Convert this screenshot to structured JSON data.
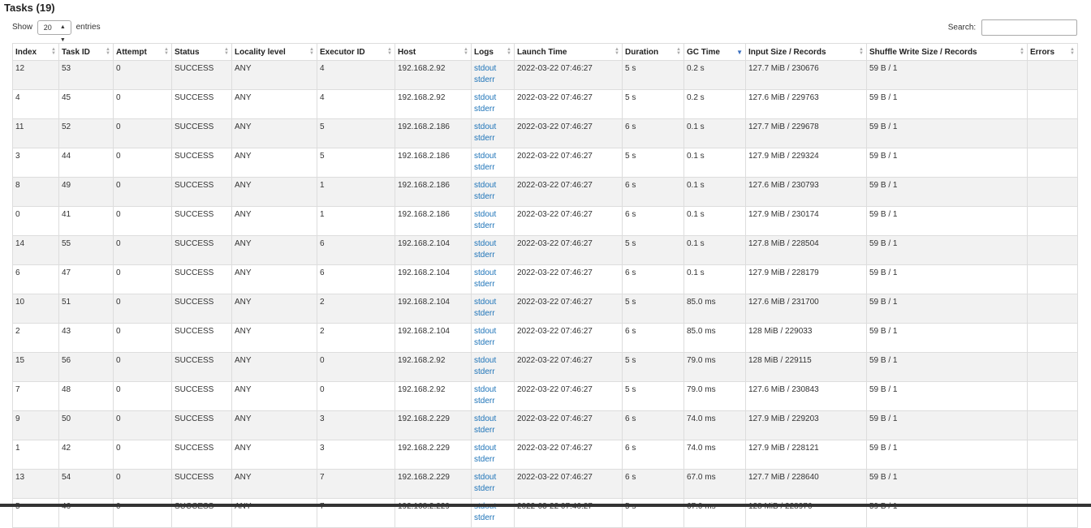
{
  "title": "Tasks (19)",
  "controls": {
    "show_label": "Show",
    "page_size": "20",
    "entries_label": "entries",
    "search_label": "Search:",
    "search_value": ""
  },
  "columns": [
    "Index",
    "Task ID",
    "Attempt",
    "Status",
    "Locality level",
    "Executor ID",
    "Host",
    "Logs",
    "Launch Time",
    "Duration",
    "GC Time",
    "Input Size / Records",
    "Shuffle Write Size / Records",
    "Errors"
  ],
  "sorted_column": "GC Time",
  "rows": [
    {
      "index": "12",
      "task_id": "53",
      "attempt": "0",
      "status": "SUCCESS",
      "locality": "ANY",
      "executor": "4",
      "host": "192.168.2.92",
      "stdout": "stdout",
      "stderr": "stderr",
      "launch": "2022-03-22 07:46:27",
      "duration": "5 s",
      "gc": "0.2 s",
      "input": "127.7 MiB / 230676",
      "shuffle": "59 B / 1",
      "errors": ""
    },
    {
      "index": "4",
      "task_id": "45",
      "attempt": "0",
      "status": "SUCCESS",
      "locality": "ANY",
      "executor": "4",
      "host": "192.168.2.92",
      "stdout": "stdout",
      "stderr": "stderr",
      "launch": "2022-03-22 07:46:27",
      "duration": "5 s",
      "gc": "0.2 s",
      "input": "127.6 MiB / 229763",
      "shuffle": "59 B / 1",
      "errors": ""
    },
    {
      "index": "11",
      "task_id": "52",
      "attempt": "0",
      "status": "SUCCESS",
      "locality": "ANY",
      "executor": "5",
      "host": "192.168.2.186",
      "stdout": "stdout",
      "stderr": "stderr",
      "launch": "2022-03-22 07:46:27",
      "duration": "6 s",
      "gc": "0.1 s",
      "input": "127.7 MiB / 229678",
      "shuffle": "59 B / 1",
      "errors": ""
    },
    {
      "index": "3",
      "task_id": "44",
      "attempt": "0",
      "status": "SUCCESS",
      "locality": "ANY",
      "executor": "5",
      "host": "192.168.2.186",
      "stdout": "stdout",
      "stderr": "stderr",
      "launch": "2022-03-22 07:46:27",
      "duration": "5 s",
      "gc": "0.1 s",
      "input": "127.9 MiB / 229324",
      "shuffle": "59 B / 1",
      "errors": ""
    },
    {
      "index": "8",
      "task_id": "49",
      "attempt": "0",
      "status": "SUCCESS",
      "locality": "ANY",
      "executor": "1",
      "host": "192.168.2.186",
      "stdout": "stdout",
      "stderr": "stderr",
      "launch": "2022-03-22 07:46:27",
      "duration": "6 s",
      "gc": "0.1 s",
      "input": "127.6 MiB / 230793",
      "shuffle": "59 B / 1",
      "errors": ""
    },
    {
      "index": "0",
      "task_id": "41",
      "attempt": "0",
      "status": "SUCCESS",
      "locality": "ANY",
      "executor": "1",
      "host": "192.168.2.186",
      "stdout": "stdout",
      "stderr": "stderr",
      "launch": "2022-03-22 07:46:27",
      "duration": "6 s",
      "gc": "0.1 s",
      "input": "127.9 MiB / 230174",
      "shuffle": "59 B / 1",
      "errors": ""
    },
    {
      "index": "14",
      "task_id": "55",
      "attempt": "0",
      "status": "SUCCESS",
      "locality": "ANY",
      "executor": "6",
      "host": "192.168.2.104",
      "stdout": "stdout",
      "stderr": "stderr",
      "launch": "2022-03-22 07:46:27",
      "duration": "5 s",
      "gc": "0.1 s",
      "input": "127.8 MiB / 228504",
      "shuffle": "59 B / 1",
      "errors": ""
    },
    {
      "index": "6",
      "task_id": "47",
      "attempt": "0",
      "status": "SUCCESS",
      "locality": "ANY",
      "executor": "6",
      "host": "192.168.2.104",
      "stdout": "stdout",
      "stderr": "stderr",
      "launch": "2022-03-22 07:46:27",
      "duration": "6 s",
      "gc": "0.1 s",
      "input": "127.9 MiB / 228179",
      "shuffle": "59 B / 1",
      "errors": ""
    },
    {
      "index": "10",
      "task_id": "51",
      "attempt": "0",
      "status": "SUCCESS",
      "locality": "ANY",
      "executor": "2",
      "host": "192.168.2.104",
      "stdout": "stdout",
      "stderr": "stderr",
      "launch": "2022-03-22 07:46:27",
      "duration": "5 s",
      "gc": "85.0 ms",
      "input": "127.6 MiB / 231700",
      "shuffle": "59 B / 1",
      "errors": ""
    },
    {
      "index": "2",
      "task_id": "43",
      "attempt": "0",
      "status": "SUCCESS",
      "locality": "ANY",
      "executor": "2",
      "host": "192.168.2.104",
      "stdout": "stdout",
      "stderr": "stderr",
      "launch": "2022-03-22 07:46:27",
      "duration": "6 s",
      "gc": "85.0 ms",
      "input": "128 MiB / 229033",
      "shuffle": "59 B / 1",
      "errors": ""
    },
    {
      "index": "15",
      "task_id": "56",
      "attempt": "0",
      "status": "SUCCESS",
      "locality": "ANY",
      "executor": "0",
      "host": "192.168.2.92",
      "stdout": "stdout",
      "stderr": "stderr",
      "launch": "2022-03-22 07:46:27",
      "duration": "5 s",
      "gc": "79.0 ms",
      "input": "128 MiB / 229115",
      "shuffle": "59 B / 1",
      "errors": ""
    },
    {
      "index": "7",
      "task_id": "48",
      "attempt": "0",
      "status": "SUCCESS",
      "locality": "ANY",
      "executor": "0",
      "host": "192.168.2.92",
      "stdout": "stdout",
      "stderr": "stderr",
      "launch": "2022-03-22 07:46:27",
      "duration": "5 s",
      "gc": "79.0 ms",
      "input": "127.6 MiB / 230843",
      "shuffle": "59 B / 1",
      "errors": ""
    },
    {
      "index": "9",
      "task_id": "50",
      "attempt": "0",
      "status": "SUCCESS",
      "locality": "ANY",
      "executor": "3",
      "host": "192.168.2.229",
      "stdout": "stdout",
      "stderr": "stderr",
      "launch": "2022-03-22 07:46:27",
      "duration": "6 s",
      "gc": "74.0 ms",
      "input": "127.9 MiB / 229203",
      "shuffle": "59 B / 1",
      "errors": ""
    },
    {
      "index": "1",
      "task_id": "42",
      "attempt": "0",
      "status": "SUCCESS",
      "locality": "ANY",
      "executor": "3",
      "host": "192.168.2.229",
      "stdout": "stdout",
      "stderr": "stderr",
      "launch": "2022-03-22 07:46:27",
      "duration": "6 s",
      "gc": "74.0 ms",
      "input": "127.9 MiB / 228121",
      "shuffle": "59 B / 1",
      "errors": ""
    },
    {
      "index": "13",
      "task_id": "54",
      "attempt": "0",
      "status": "SUCCESS",
      "locality": "ANY",
      "executor": "7",
      "host": "192.168.2.229",
      "stdout": "stdout",
      "stderr": "stderr",
      "launch": "2022-03-22 07:46:27",
      "duration": "6 s",
      "gc": "67.0 ms",
      "input": "127.7 MiB / 228640",
      "shuffle": "59 B / 1",
      "errors": ""
    },
    {
      "index": "5",
      "task_id": "46",
      "attempt": "0",
      "status": "SUCCESS",
      "locality": "ANY",
      "executor": "7",
      "host": "192.168.2.229",
      "stdout": "stdout",
      "stderr": "stderr",
      "launch": "2022-03-22 07:46:27",
      "duration": "5 s",
      "gc": "67.0 ms",
      "input": "128 MiB / 228976",
      "shuffle": "59 B / 1",
      "errors": ""
    }
  ],
  "colors": {
    "link": "#1d73b8",
    "row_alt": "#f2f2f2",
    "border": "#dddddd",
    "sort_active": "#3a6fbf"
  }
}
